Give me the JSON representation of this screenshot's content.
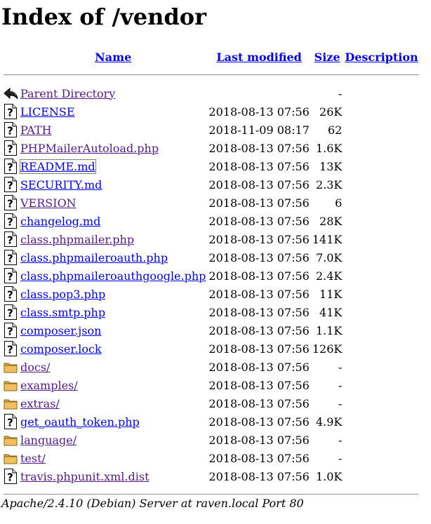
{
  "title": "Index of /vendor",
  "columns": {
    "name": "Name",
    "last_modified": "Last modified",
    "size": "Size",
    "description": "Description"
  },
  "entries": [
    {
      "type": "parent",
      "icon": "back-icon",
      "name": "Parent Directory",
      "modified": "",
      "size": "-",
      "visited": true
    },
    {
      "type": "file",
      "icon": "unknown-file-icon",
      "name": "LICENSE",
      "modified": "2018-08-13 07:56",
      "size": "26K",
      "visited": false
    },
    {
      "type": "file",
      "icon": "unknown-file-icon",
      "name": "PATH",
      "modified": "2018-11-09 08:17",
      "size": "62",
      "visited": true
    },
    {
      "type": "file",
      "icon": "unknown-file-icon",
      "name": "PHPMailerAutoload.php",
      "modified": "2018-08-13 07:56",
      "size": "1.6K",
      "visited": true
    },
    {
      "type": "file",
      "icon": "unknown-file-icon",
      "name": "README.md",
      "modified": "2018-08-13 07:56",
      "size": "13K",
      "visited": false,
      "focused": true
    },
    {
      "type": "file",
      "icon": "unknown-file-icon",
      "name": "SECURITY.md",
      "modified": "2018-08-13 07:56",
      "size": "2.3K",
      "visited": false
    },
    {
      "type": "file",
      "icon": "unknown-file-icon",
      "name": "VERSION",
      "modified": "2018-08-13 07:56",
      "size": "6",
      "visited": true
    },
    {
      "type": "file",
      "icon": "unknown-file-icon",
      "name": "changelog.md",
      "modified": "2018-08-13 07:56",
      "size": "28K",
      "visited": false
    },
    {
      "type": "file",
      "icon": "unknown-file-icon",
      "name": "class.phpmailer.php",
      "modified": "2018-08-13 07:56",
      "size": "141K",
      "visited": true
    },
    {
      "type": "file",
      "icon": "unknown-file-icon",
      "name": "class.phpmaileroauth.php",
      "modified": "2018-08-13 07:56",
      "size": "7.0K",
      "visited": false
    },
    {
      "type": "file",
      "icon": "unknown-file-icon",
      "name": "class.phpmaileroauthgoogle.php",
      "modified": "2018-08-13 07:56",
      "size": "2.4K",
      "visited": false
    },
    {
      "type": "file",
      "icon": "unknown-file-icon",
      "name": "class.pop3.php",
      "modified": "2018-08-13 07:56",
      "size": "11K",
      "visited": false
    },
    {
      "type": "file",
      "icon": "unknown-file-icon",
      "name": "class.smtp.php",
      "modified": "2018-08-13 07:56",
      "size": "41K",
      "visited": false
    },
    {
      "type": "file",
      "icon": "unknown-file-icon",
      "name": "composer.json",
      "modified": "2018-08-13 07:56",
      "size": "1.1K",
      "visited": false
    },
    {
      "type": "file",
      "icon": "unknown-file-icon",
      "name": "composer.lock",
      "modified": "2018-08-13 07:56",
      "size": "126K",
      "visited": false
    },
    {
      "type": "folder",
      "icon": "folder-icon",
      "name": "docs/",
      "modified": "2018-08-13 07:56",
      "size": "-",
      "visited": true
    },
    {
      "type": "folder",
      "icon": "folder-icon",
      "name": "examples/",
      "modified": "2018-08-13 07:56",
      "size": "-",
      "visited": true
    },
    {
      "type": "folder",
      "icon": "folder-icon",
      "name": "extras/",
      "modified": "2018-08-13 07:56",
      "size": "-",
      "visited": true
    },
    {
      "type": "file",
      "icon": "unknown-file-icon",
      "name": "get_oauth_token.php",
      "modified": "2018-08-13 07:56",
      "size": "4.9K",
      "visited": false
    },
    {
      "type": "folder",
      "icon": "folder-icon",
      "name": "language/",
      "modified": "2018-08-13 07:56",
      "size": "-",
      "visited": true
    },
    {
      "type": "folder",
      "icon": "folder-icon",
      "name": "test/",
      "modified": "2018-08-13 07:56",
      "size": "-",
      "visited": true
    },
    {
      "type": "file",
      "icon": "unknown-file-icon",
      "name": "travis.phpunit.xml.dist",
      "modified": "2018-08-13 07:56",
      "size": "1.0K",
      "visited": true
    }
  ],
  "footer": "Apache/2.4.10 (Debian) Server at raven.local Port 80",
  "colors": {
    "link": "#0000ee",
    "visited_link": "#551a8b",
    "folder": "#d9a441"
  }
}
